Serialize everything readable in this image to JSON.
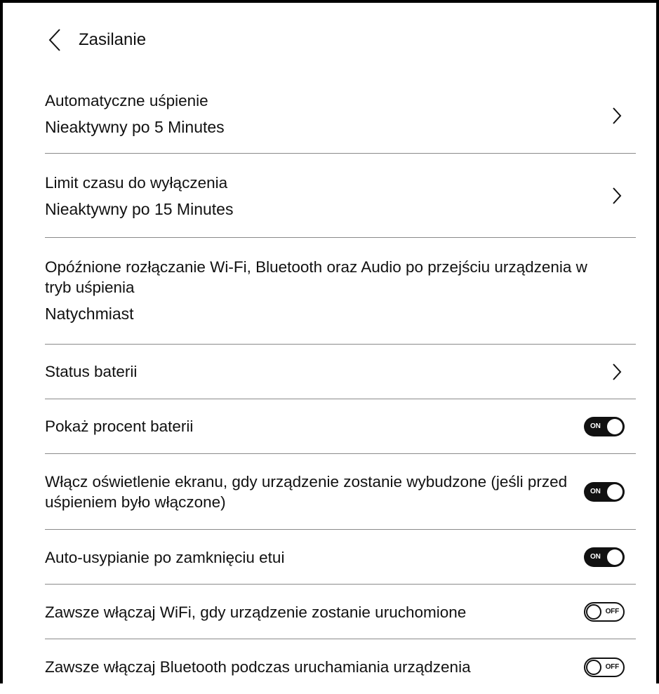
{
  "header": {
    "back_icon": "chevron-left-icon",
    "title": "Zasilanie"
  },
  "rows": [
    {
      "title": "Automatyczne uśpienie",
      "value": "Nieaktywny po 5 Minutes",
      "trailing": "chevron-right-icon"
    },
    {
      "title": "Limit czasu do wyłączenia",
      "value": "Nieaktywny po 15 Minutes",
      "trailing": "chevron-right-icon"
    },
    {
      "title": "Opóźnione rozłączanie Wi-Fi, Bluetooth oraz Audio po przejściu urządzenia w tryb uśpienia",
      "value": "Natychmiast"
    },
    {
      "title": "Status baterii",
      "trailing": "chevron-right-icon"
    },
    {
      "title": "Pokaż procent baterii",
      "toggle": {
        "state": "on",
        "label": "ON"
      }
    },
    {
      "title": "Włącz oświetlenie ekranu, gdy urządzenie zostanie wybudzone (jeśli przed uśpieniem było włączone)",
      "toggle": {
        "state": "on",
        "label": "ON"
      }
    },
    {
      "title": "Auto-usypianie po zamknięciu etui",
      "toggle": {
        "state": "on",
        "label": "ON"
      }
    },
    {
      "title": "Zawsze włączaj WiFi, gdy urządzenie zostanie uruchomione",
      "toggle": {
        "state": "off",
        "label": "OFF"
      }
    },
    {
      "title": "Zawsze włączaj Bluetooth podczas uruchamiania urządzenia",
      "toggle": {
        "state": "off",
        "label": "OFF"
      }
    }
  ],
  "colors": {
    "text": "#111111",
    "divider": "#8a8a8a",
    "toggle_on": "#111111",
    "background": "#ffffff"
  }
}
